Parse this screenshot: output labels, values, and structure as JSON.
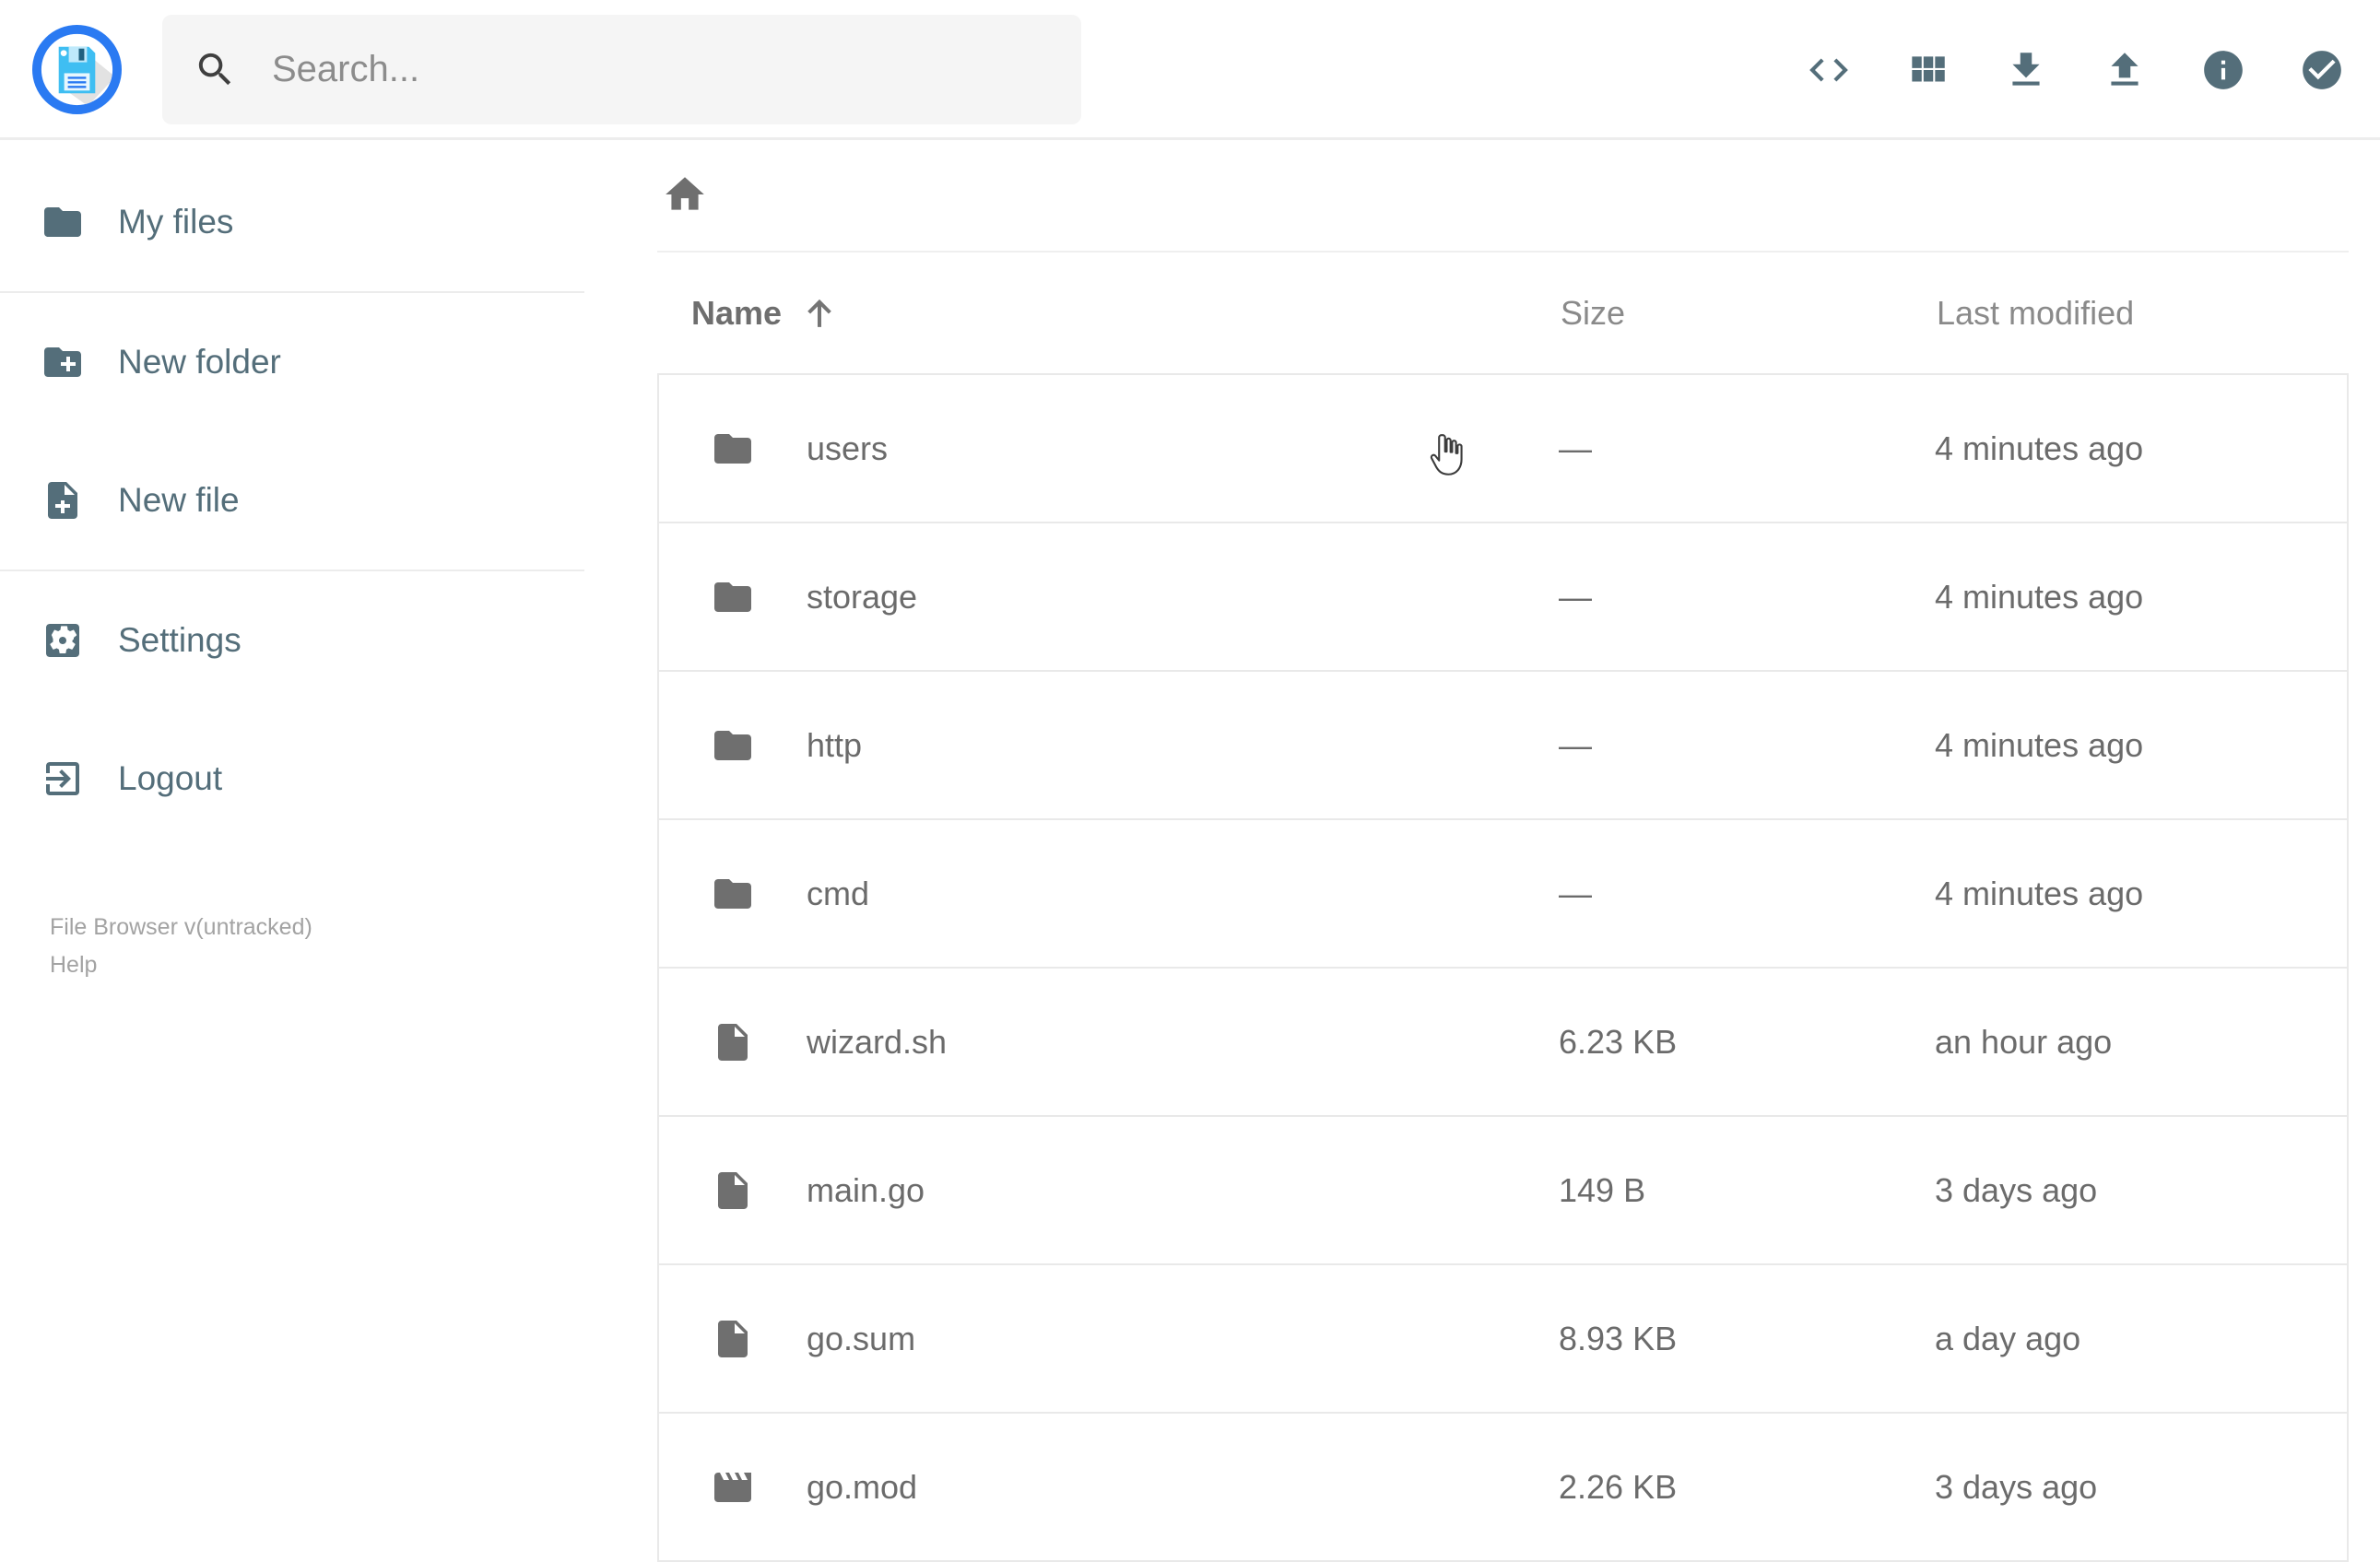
{
  "app": {
    "name": "File Browser"
  },
  "colors": {
    "brand_blue": "#2a7af2",
    "toolbar_icon": "#546e7a",
    "sidebar_text": "#546e7a",
    "list_icon": "#6f6f6f",
    "list_text": "#6b6b6b",
    "muted_text": "#8a8a8a",
    "search_bg": "#f5f5f5",
    "divider": "#e9e9e9"
  },
  "header": {
    "search": {
      "placeholder": "Search..."
    },
    "actions": [
      {
        "name": "raw-view",
        "icon": "code-icon"
      },
      {
        "name": "switch-view",
        "icon": "grid-icon"
      },
      {
        "name": "download",
        "icon": "download-icon"
      },
      {
        "name": "upload",
        "icon": "upload-icon"
      },
      {
        "name": "info",
        "icon": "info-icon"
      },
      {
        "name": "select-multiple",
        "icon": "check-circle-icon"
      }
    ]
  },
  "sidebar": {
    "items": [
      {
        "label": "My files",
        "icon": "folder-icon"
      },
      {
        "label": "New folder",
        "icon": "create-new-folder-icon"
      },
      {
        "label": "New file",
        "icon": "note-add-icon"
      },
      {
        "label": "Settings",
        "icon": "settings-icon"
      },
      {
        "label": "Logout",
        "icon": "logout-icon"
      }
    ],
    "footer": {
      "version": "File Browser v(untracked)",
      "help": "Help"
    }
  },
  "breadcrumb": {
    "root_icon": "home-icon"
  },
  "listing": {
    "columns": {
      "name": "Name",
      "size": "Size",
      "modified": "Last modified"
    },
    "sort": {
      "column": "name",
      "direction": "ascending"
    },
    "rows": [
      {
        "name": "users",
        "icon": "folder",
        "size": "—",
        "modified": "4 minutes ago"
      },
      {
        "name": "storage",
        "icon": "folder",
        "size": "—",
        "modified": "4 minutes ago"
      },
      {
        "name": "http",
        "icon": "folder",
        "size": "—",
        "modified": "4 minutes ago"
      },
      {
        "name": "cmd",
        "icon": "folder",
        "size": "—",
        "modified": "4 minutes ago"
      },
      {
        "name": "wizard.sh",
        "icon": "file",
        "size": "6.23 KB",
        "modified": "an hour ago"
      },
      {
        "name": "main.go",
        "icon": "file",
        "size": "149 B",
        "modified": "3 days ago"
      },
      {
        "name": "go.sum",
        "icon": "file",
        "size": "8.93 KB",
        "modified": "a day ago"
      },
      {
        "name": "go.mod",
        "icon": "movie",
        "size": "2.26 KB",
        "modified": "3 days ago"
      }
    ]
  }
}
